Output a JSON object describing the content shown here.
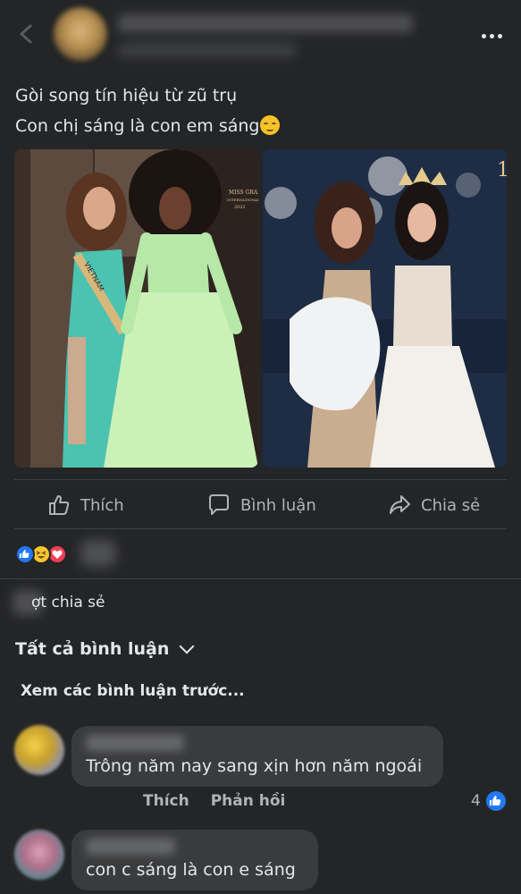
{
  "post": {
    "caption_line1": "Gòi song tín hiệu từ zũ trụ",
    "caption_line2": "Con chị sáng là con em sáng",
    "caption_emoji": "relieved-face-emoji",
    "images": [
      {
        "name": "photo-left",
        "badge_text": "MISS GRAND INTERNATIONAL 2021",
        "sash_text": "VIETNAM"
      },
      {
        "name": "photo-right",
        "corner_text": "1"
      }
    ]
  },
  "actions": {
    "like_label": "Thích",
    "comment_label": "Bình luận",
    "share_label": "Chia sẻ"
  },
  "reactions": {
    "icons": [
      "like-icon",
      "haha-icon",
      "love-icon"
    ]
  },
  "shares": {
    "text": "ợt chia sẻ"
  },
  "comments_section": {
    "filter_label": "Tất cả bình luận",
    "view_previous": "Xem các bình luận trước...",
    "comments": [
      {
        "text": "Trông năm nay sang xịn hơn năm ngoái",
        "like_action": "Thích",
        "reply_action": "Phản hồi",
        "like_count": "4"
      },
      {
        "text": "con c sáng là con e sáng"
      }
    ]
  },
  "colors": {
    "background": "#242526",
    "bubble": "#3a3b3c",
    "text_primary": "#e4e6eb",
    "text_secondary": "#b0b3b8",
    "like_blue": "#2078f4",
    "love_red": "#f33e58",
    "haha_yellow": "#f7c531"
  }
}
